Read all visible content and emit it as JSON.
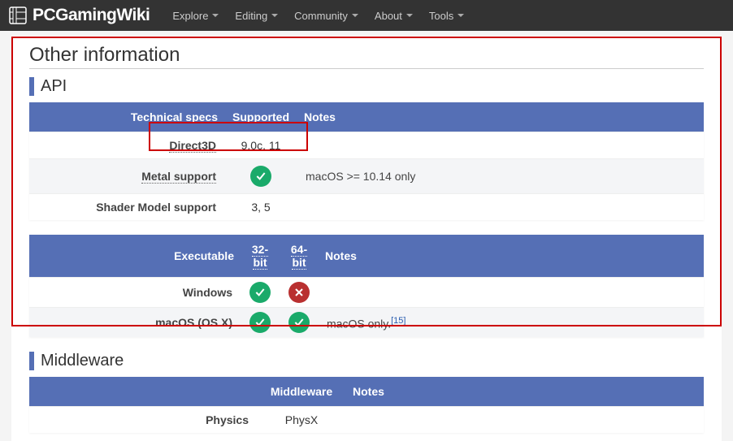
{
  "logo_text": "PCGamingWiki",
  "nav": [
    "Explore",
    "Editing",
    "Community",
    "About",
    "Tools"
  ],
  "section_title": "Other information",
  "api": {
    "heading": "API",
    "headers": {
      "specs": "Technical specs",
      "supported": "Supported",
      "notes": "Notes"
    },
    "rows": [
      {
        "label": "Direct3D",
        "dotted": true,
        "value_text": "9.0c, 11",
        "notes": ""
      },
      {
        "label": "Metal support",
        "dotted": true,
        "tick": true,
        "notes": "macOS >= 10.14 only"
      },
      {
        "label": "Shader Model support",
        "dotted": false,
        "value_text": "3, 5",
        "notes": ""
      }
    ]
  },
  "exec": {
    "headers": {
      "exec": "Executable",
      "b32": "32-bit",
      "b64": "64-bit",
      "notes": "Notes"
    },
    "rows": [
      {
        "label": "Windows",
        "c32": "tick",
        "c64": "cross",
        "notes": "",
        "ref": ""
      },
      {
        "label": "macOS (OS X)",
        "c32": "tick",
        "c64": "tick",
        "notes": "macOS only.",
        "ref": "[15]"
      }
    ]
  },
  "middleware": {
    "heading": "Middleware",
    "headers": {
      "mw": "Middleware",
      "notes": "Notes"
    },
    "rows": [
      {
        "label": "Physics",
        "value": "PhysX",
        "notes": ""
      }
    ]
  }
}
